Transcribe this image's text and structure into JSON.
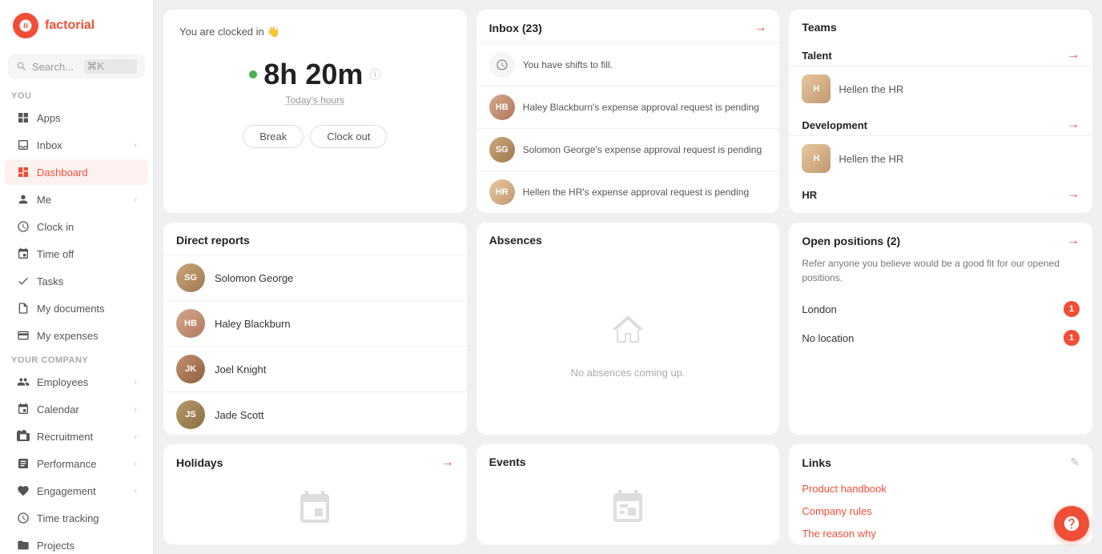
{
  "app": {
    "name": "factorial"
  },
  "search": {
    "placeholder": "Search...",
    "shortcut": "⌘K"
  },
  "sidebar": {
    "section_you": "YOU",
    "section_company": "YOUR COMPANY",
    "items_you": [
      {
        "id": "apps",
        "label": "Apps",
        "icon": "grid"
      },
      {
        "id": "inbox",
        "label": "Inbox",
        "icon": "inbox",
        "has_chevron": true
      },
      {
        "id": "dashboard",
        "label": "Dashboard",
        "icon": "home",
        "active": true
      },
      {
        "id": "me",
        "label": "Me",
        "icon": "person",
        "has_chevron": true
      },
      {
        "id": "clock-in",
        "label": "Clock in",
        "icon": "clock"
      },
      {
        "id": "time-off",
        "label": "Time off",
        "icon": "calendar"
      },
      {
        "id": "tasks",
        "label": "Tasks",
        "icon": "check"
      },
      {
        "id": "my-documents",
        "label": "My documents",
        "icon": "file"
      },
      {
        "id": "my-expenses",
        "label": "My expenses",
        "icon": "receipt"
      }
    ],
    "items_company": [
      {
        "id": "employees",
        "label": "Employees",
        "icon": "people",
        "has_chevron": true
      },
      {
        "id": "calendar",
        "label": "Calendar",
        "icon": "calendar2",
        "has_chevron": true
      },
      {
        "id": "recruitment",
        "label": "Recruitment",
        "icon": "briefcase",
        "has_chevron": true
      },
      {
        "id": "performance",
        "label": "Performance",
        "icon": "chart",
        "has_chevron": true
      },
      {
        "id": "engagement",
        "label": "Engagement",
        "icon": "heart",
        "has_chevron": true
      },
      {
        "id": "time-tracking",
        "label": "Time tracking",
        "icon": "clock2"
      },
      {
        "id": "projects",
        "label": "Projects",
        "icon": "folder"
      }
    ]
  },
  "clock_widget": {
    "status": "You are clocked in 👋",
    "time": "8h 20m",
    "label": "Today's hours",
    "break_btn": "Break",
    "clockout_btn": "Clock out"
  },
  "inbox": {
    "title": "Inbox (23)",
    "items": [
      {
        "text": "You have shifts to fill.",
        "type": "shift"
      },
      {
        "name": "Haley Blackburn",
        "text": "Haley Blackburn's expense approval request is pending",
        "initials": "HB"
      },
      {
        "name": "Solomon George",
        "text": "Solomon George's expense approval request is pending",
        "initials": "SG"
      },
      {
        "name": "Hellen the HR",
        "text": "Hellen the HR's expense approval request is pending",
        "initials": "HR"
      }
    ]
  },
  "teams": {
    "title": "Teams",
    "sections": [
      {
        "name": "Talent",
        "members": [
          {
            "name": "Hellen the HR",
            "initials": "H"
          }
        ]
      },
      {
        "name": "Development",
        "members": [
          {
            "name": "Hellen the HR",
            "initials": "H"
          }
        ]
      },
      {
        "name": "HR",
        "members": []
      }
    ]
  },
  "direct_reports": {
    "title": "Direct reports",
    "people": [
      {
        "name": "Solomon George",
        "initials": "SG"
      },
      {
        "name": "Haley Blackburn",
        "initials": "HB"
      },
      {
        "name": "Joel Knight",
        "initials": "JK"
      },
      {
        "name": "Jade Scott",
        "initials": "JS"
      }
    ]
  },
  "absences": {
    "title": "Absences",
    "empty_text": "No absences coming up."
  },
  "open_positions": {
    "title": "Open positions (2)",
    "description": "Refer anyone you believe would be a good fit for our opened positions.",
    "positions": [
      {
        "name": "London",
        "count": 1
      },
      {
        "name": "No location",
        "count": 1
      }
    ]
  },
  "holidays": {
    "title": "Holidays"
  },
  "events": {
    "title": "Events"
  },
  "links": {
    "title": "Links",
    "items": [
      {
        "label": "Product handbook"
      },
      {
        "label": "Company rules"
      },
      {
        "label": "The reason why"
      }
    ]
  }
}
